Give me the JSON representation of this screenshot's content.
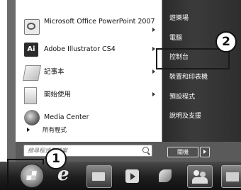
{
  "start_menu": {
    "programs": [
      {
        "label": "Microsoft Office PowerPoint 2007",
        "icon": "powerpoint-icon",
        "has_submenu": true
      },
      {
        "label": "Adobe Illustrator CS4",
        "icon_text": "Ai",
        "icon": "illustrator-icon",
        "has_submenu": true
      },
      {
        "label": "記事本",
        "icon": "notepad-icon",
        "has_submenu": true
      },
      {
        "label": "開始使用",
        "icon": "getting-started-icon",
        "has_submenu": true
      },
      {
        "label": "Media Center",
        "icon": "media-center-icon",
        "has_submenu": false
      }
    ],
    "all_programs": "所有程式",
    "search_placeholder": "搜尋程式及檔案",
    "right_items": [
      "遊樂場",
      "電腦",
      "控制台",
      "裝置和印表機",
      "預設程式",
      "說明及支援"
    ],
    "shutdown_label": "關機"
  },
  "callouts": [
    "1",
    "2"
  ],
  "taskbar": {
    "items": [
      "start-orb",
      "internet-explorer-icon",
      "file-explorer-icon",
      "media-player-icon",
      "paint-icon",
      "users-icon",
      "folder-icon"
    ]
  },
  "colors": {
    "menu_frame": "#6b6b6b",
    "right_pane": "#2f2f2f",
    "taskbar": "#1e1e1e"
  }
}
